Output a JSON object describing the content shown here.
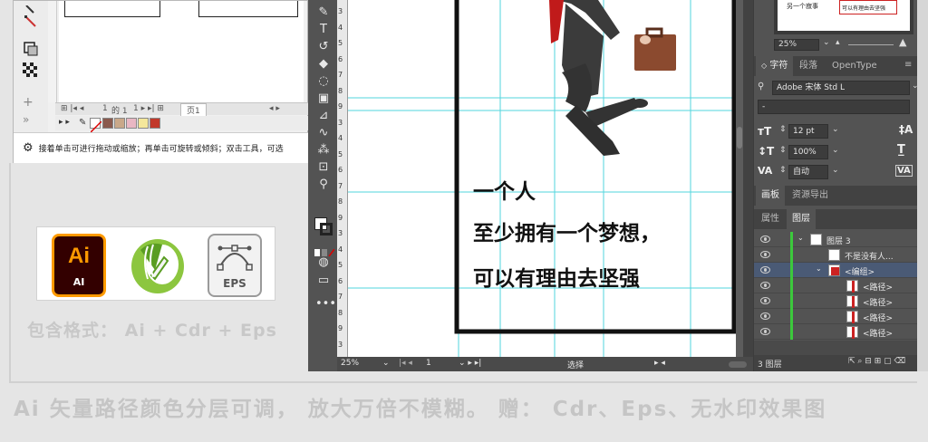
{
  "left_window": {
    "page_nav_first": "1",
    "page_nav_of": "的 1",
    "page_label": "页1",
    "status_text": "接着单击可进行拖动或缩放；再单击可旋转或倾斜；双击工具，可选"
  },
  "formats": {
    "ai_label": "Ai",
    "ai_sub": "AI",
    "eps_label": "EPS",
    "caption": "包含格式： Ai + Cdr + Eps"
  },
  "footer": {
    "text": "Ai 矢量路径颜色分层可调，  放大万倍不模糊。 赠：  Cdr、Eps、无水印效果图"
  },
  "canvas": {
    "line1": "一个人",
    "line2": "至少拥有一个梦想，",
    "line3": "可以有理由去坚强"
  },
  "ai_status": {
    "zoom": "25%",
    "page": "1",
    "mode": "选择"
  },
  "ruler": [
    "3",
    "4",
    "5",
    "6",
    "7",
    "8",
    "9",
    "3",
    "4",
    "5",
    "6",
    "7",
    "8",
    "9",
    "3",
    "4",
    "5",
    "6",
    "7",
    "8",
    "9",
    "3"
  ],
  "nav_panel": {
    "zoom": "25%",
    "thumb1": "另一个寂事",
    "thumb2": "可以有理由去坚强"
  },
  "char_panel": {
    "tabs": [
      "字符",
      "段落",
      "OpenType"
    ],
    "font": "Adobe 宋体 Std L",
    "style": "-",
    "size": "12 pt",
    "scale": "100%",
    "leading": "自动"
  },
  "side_tabs": [
    "画板",
    "资源导出"
  ],
  "layers_panel": {
    "tabs": [
      "属性",
      "图层"
    ],
    "rows": [
      {
        "name": "图层 3"
      },
      {
        "name": "不是没有人..."
      },
      {
        "name": "<编组>"
      },
      {
        "name": "<路径>"
      },
      {
        "name": "<路径>"
      },
      {
        "name": "<路径>"
      },
      {
        "name": "<路径>"
      }
    ],
    "count": "3 图层"
  },
  "colors": {
    "ai_orange": "#ff9a00",
    "ai_bg": "#330000",
    "cdr_green": "#8cc63f",
    "layer_green": "#3cc83c",
    "guide_cyan": "#34d0d8"
  }
}
